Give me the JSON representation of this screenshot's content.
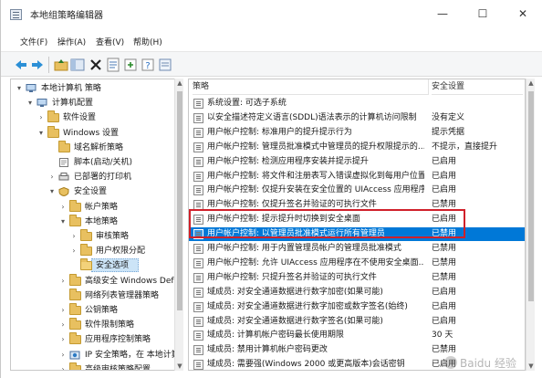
{
  "window": {
    "title": "本地组策略编辑器",
    "controls": {
      "minimize": "—",
      "maximize": "☐",
      "close": "✕"
    }
  },
  "menu": [
    "文件(F)",
    "操作(A)",
    "查看(V)",
    "帮助(H)"
  ],
  "toolbar": {
    "icons": [
      "back-arrow-icon",
      "forward-arrow-icon",
      "folder-up-icon",
      "console-tree-icon",
      "delete-icon",
      "properties-icon",
      "help-icon",
      "filter-icon"
    ]
  },
  "tree": [
    {
      "label": "本地计算机 策略",
      "icon": "computer-icon",
      "level": 0,
      "expanded": true
    },
    {
      "label": "计算机配置",
      "icon": "computer-icon",
      "level": 1,
      "expanded": true
    },
    {
      "label": "软件设置",
      "icon": "folder-icon",
      "level": 2,
      "expanded": false
    },
    {
      "label": "Windows 设置",
      "icon": "folder-icon",
      "level": 2,
      "expanded": true
    },
    {
      "label": "域名解析策略",
      "icon": "folder-icon",
      "level": 3,
      "expanded": null
    },
    {
      "label": "脚本(启动/关机)",
      "icon": "script-icon",
      "level": 3,
      "expanded": null
    },
    {
      "label": "已部署的打印机",
      "icon": "printer-icon",
      "level": 3,
      "expanded": false
    },
    {
      "label": "安全设置",
      "icon": "security-icon",
      "level": 3,
      "expanded": true
    },
    {
      "label": "帐户策略",
      "icon": "folder-icon",
      "level": 4,
      "expanded": false
    },
    {
      "label": "本地策略",
      "icon": "folder-icon",
      "level": 4,
      "expanded": true
    },
    {
      "label": "审核策略",
      "icon": "folder-icon",
      "level": 5,
      "expanded": false
    },
    {
      "label": "用户权限分配",
      "icon": "folder-icon",
      "level": 5,
      "expanded": false
    },
    {
      "label": "安全选项",
      "icon": "folder-icon",
      "level": 5,
      "expanded": null,
      "selected": true
    },
    {
      "label": "高级安全 Windows Defe",
      "icon": "folder-icon",
      "level": 4,
      "expanded": false
    },
    {
      "label": "网络列表管理器策略",
      "icon": "folder-icon",
      "level": 4,
      "expanded": null
    },
    {
      "label": "公钥策略",
      "icon": "folder-icon",
      "level": 4,
      "expanded": false
    },
    {
      "label": "软件限制策略",
      "icon": "folder-icon",
      "level": 4,
      "expanded": false
    },
    {
      "label": "应用程序控制策略",
      "icon": "folder-icon",
      "level": 4,
      "expanded": false
    },
    {
      "label": "IP 安全策略，在 本地计算",
      "icon": "ip-security-icon",
      "level": 4,
      "expanded": false
    },
    {
      "label": "高级审核策略配置",
      "icon": "folder-icon",
      "level": 4,
      "expanded": false
    }
  ],
  "list": {
    "columns": [
      "策略",
      "安全设置"
    ],
    "rows": [
      {
        "name": "系统设置: 可选子系统",
        "value": ""
      },
      {
        "name": "以安全描述符定义语言(SDDL)语法表示的计算机访问限制",
        "value": "没有定义"
      },
      {
        "name": "用户帐户控制: 标准用户的提升提示行为",
        "value": "提示凭据"
      },
      {
        "name": "用户帐户控制: 管理员批准模式中管理员的提升权限提示的...",
        "value": "不提示，直接提升"
      },
      {
        "name": "用户帐户控制: 检测应用程序安装并提示提升",
        "value": "已启用"
      },
      {
        "name": "用户帐户控制: 将文件和注册表写入错误虚拟化到每用户位置",
        "value": "已启用"
      },
      {
        "name": "用户帐户控制: 仅提升安装在安全位置的 UIAccess 应用程序",
        "value": "已启用"
      },
      {
        "name": "用户帐户控制: 仅提升签名并验证的可执行文件",
        "value": "已禁用"
      },
      {
        "name": "用户帐户控制: 提示提升时切换到安全桌面",
        "value": "已启用"
      },
      {
        "name": "用户帐户控制: 以管理员批准模式运行所有管理员",
        "value": "已禁用",
        "selected": true
      },
      {
        "name": "用户帐户控制: 用于内置管理员帐户的管理员批准模式",
        "value": "已禁用"
      },
      {
        "name": "用户帐户控制: 允许 UIAccess 应用程序在不使用安全桌面...",
        "value": "已禁用"
      },
      {
        "name": "用户帐户控制: 只提升签名并验证的可执行文件",
        "value": "已禁用"
      },
      {
        "name": "域成员: 对安全通道数据进行数字加密(如果可能)",
        "value": "已启用"
      },
      {
        "name": "域成员: 对安全通道数据进行数字加密或数字签名(始终)",
        "value": "已启用"
      },
      {
        "name": "域成员: 对安全通道数据进行数字签名(如果可能)",
        "value": "已启用"
      },
      {
        "name": "域成员: 计算机帐户密码最长使用期限",
        "value": "30 天"
      },
      {
        "name": "域成员: 禁用计算机帐户密码更改",
        "value": "已禁用"
      },
      {
        "name": "域成员: 需要强(Windows 2000 或更高版本)会话密钥",
        "value": "已启用"
      }
    ]
  },
  "watermark": "Baidu 经验"
}
